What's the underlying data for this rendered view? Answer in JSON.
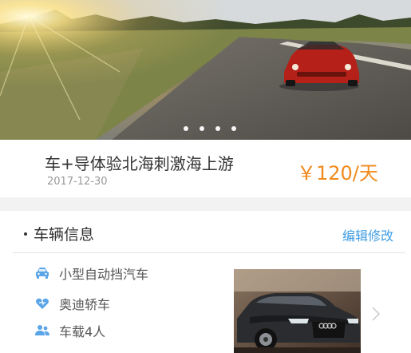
{
  "banner": {
    "image": "car-on-road-photo",
    "pager_dots": 4
  },
  "product": {
    "title": "车+导体验北海刺激海上游",
    "date": "2017-12-30",
    "price": "￥120/天"
  },
  "vehicle_info": {
    "section_title": "车辆信息",
    "edit_label": "编辑修改",
    "items": [
      {
        "icon": "car-icon",
        "label": "小型自动挡汽车"
      },
      {
        "icon": "heart-icon",
        "label": "奥迪轿车"
      },
      {
        "icon": "people-icon",
        "label": "车载4人"
      }
    ],
    "photo": "audi-car-photo"
  },
  "colors": {
    "accent_orange": "#f08a1c",
    "link_blue": "#3f9de3",
    "icon_blue": "#5aa5e8"
  }
}
